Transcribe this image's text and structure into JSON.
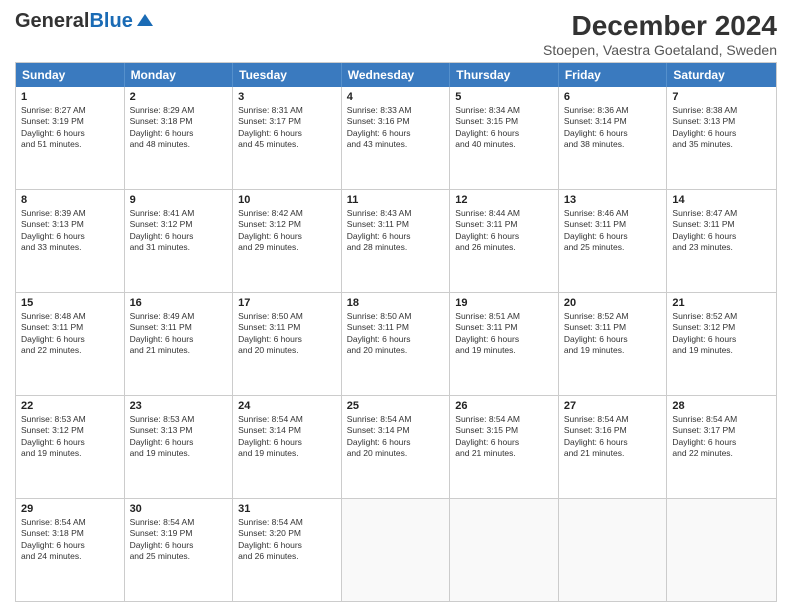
{
  "header": {
    "logo_line1": "General",
    "logo_line2": "Blue",
    "title": "December 2024",
    "subtitle": "Stoepen, Vaestra Goetaland, Sweden"
  },
  "days_of_week": [
    "Sunday",
    "Monday",
    "Tuesday",
    "Wednesday",
    "Thursday",
    "Friday",
    "Saturday"
  ],
  "weeks": [
    [
      {
        "day": "1",
        "lines": [
          "Sunrise: 8:27 AM",
          "Sunset: 3:19 PM",
          "Daylight: 6 hours",
          "and 51 minutes."
        ]
      },
      {
        "day": "2",
        "lines": [
          "Sunrise: 8:29 AM",
          "Sunset: 3:18 PM",
          "Daylight: 6 hours",
          "and 48 minutes."
        ]
      },
      {
        "day": "3",
        "lines": [
          "Sunrise: 8:31 AM",
          "Sunset: 3:17 PM",
          "Daylight: 6 hours",
          "and 45 minutes."
        ]
      },
      {
        "day": "4",
        "lines": [
          "Sunrise: 8:33 AM",
          "Sunset: 3:16 PM",
          "Daylight: 6 hours",
          "and 43 minutes."
        ]
      },
      {
        "day": "5",
        "lines": [
          "Sunrise: 8:34 AM",
          "Sunset: 3:15 PM",
          "Daylight: 6 hours",
          "and 40 minutes."
        ]
      },
      {
        "day": "6",
        "lines": [
          "Sunrise: 8:36 AM",
          "Sunset: 3:14 PM",
          "Daylight: 6 hours",
          "and 38 minutes."
        ]
      },
      {
        "day": "7",
        "lines": [
          "Sunrise: 8:38 AM",
          "Sunset: 3:13 PM",
          "Daylight: 6 hours",
          "and 35 minutes."
        ]
      }
    ],
    [
      {
        "day": "8",
        "lines": [
          "Sunrise: 8:39 AM",
          "Sunset: 3:13 PM",
          "Daylight: 6 hours",
          "and 33 minutes."
        ]
      },
      {
        "day": "9",
        "lines": [
          "Sunrise: 8:41 AM",
          "Sunset: 3:12 PM",
          "Daylight: 6 hours",
          "and 31 minutes."
        ]
      },
      {
        "day": "10",
        "lines": [
          "Sunrise: 8:42 AM",
          "Sunset: 3:12 PM",
          "Daylight: 6 hours",
          "and 29 minutes."
        ]
      },
      {
        "day": "11",
        "lines": [
          "Sunrise: 8:43 AM",
          "Sunset: 3:11 PM",
          "Daylight: 6 hours",
          "and 28 minutes."
        ]
      },
      {
        "day": "12",
        "lines": [
          "Sunrise: 8:44 AM",
          "Sunset: 3:11 PM",
          "Daylight: 6 hours",
          "and 26 minutes."
        ]
      },
      {
        "day": "13",
        "lines": [
          "Sunrise: 8:46 AM",
          "Sunset: 3:11 PM",
          "Daylight: 6 hours",
          "and 25 minutes."
        ]
      },
      {
        "day": "14",
        "lines": [
          "Sunrise: 8:47 AM",
          "Sunset: 3:11 PM",
          "Daylight: 6 hours",
          "and 23 minutes."
        ]
      }
    ],
    [
      {
        "day": "15",
        "lines": [
          "Sunrise: 8:48 AM",
          "Sunset: 3:11 PM",
          "Daylight: 6 hours",
          "and 22 minutes."
        ]
      },
      {
        "day": "16",
        "lines": [
          "Sunrise: 8:49 AM",
          "Sunset: 3:11 PM",
          "Daylight: 6 hours",
          "and 21 minutes."
        ]
      },
      {
        "day": "17",
        "lines": [
          "Sunrise: 8:50 AM",
          "Sunset: 3:11 PM",
          "Daylight: 6 hours",
          "and 20 minutes."
        ]
      },
      {
        "day": "18",
        "lines": [
          "Sunrise: 8:50 AM",
          "Sunset: 3:11 PM",
          "Daylight: 6 hours",
          "and 20 minutes."
        ]
      },
      {
        "day": "19",
        "lines": [
          "Sunrise: 8:51 AM",
          "Sunset: 3:11 PM",
          "Daylight: 6 hours",
          "and 19 minutes."
        ]
      },
      {
        "day": "20",
        "lines": [
          "Sunrise: 8:52 AM",
          "Sunset: 3:11 PM",
          "Daylight: 6 hours",
          "and 19 minutes."
        ]
      },
      {
        "day": "21",
        "lines": [
          "Sunrise: 8:52 AM",
          "Sunset: 3:12 PM",
          "Daylight: 6 hours",
          "and 19 minutes."
        ]
      }
    ],
    [
      {
        "day": "22",
        "lines": [
          "Sunrise: 8:53 AM",
          "Sunset: 3:12 PM",
          "Daylight: 6 hours",
          "and 19 minutes."
        ]
      },
      {
        "day": "23",
        "lines": [
          "Sunrise: 8:53 AM",
          "Sunset: 3:13 PM",
          "Daylight: 6 hours",
          "and 19 minutes."
        ]
      },
      {
        "day": "24",
        "lines": [
          "Sunrise: 8:54 AM",
          "Sunset: 3:14 PM",
          "Daylight: 6 hours",
          "and 19 minutes."
        ]
      },
      {
        "day": "25",
        "lines": [
          "Sunrise: 8:54 AM",
          "Sunset: 3:14 PM",
          "Daylight: 6 hours",
          "and 20 minutes."
        ]
      },
      {
        "day": "26",
        "lines": [
          "Sunrise: 8:54 AM",
          "Sunset: 3:15 PM",
          "Daylight: 6 hours",
          "and 21 minutes."
        ]
      },
      {
        "day": "27",
        "lines": [
          "Sunrise: 8:54 AM",
          "Sunset: 3:16 PM",
          "Daylight: 6 hours",
          "and 21 minutes."
        ]
      },
      {
        "day": "28",
        "lines": [
          "Sunrise: 8:54 AM",
          "Sunset: 3:17 PM",
          "Daylight: 6 hours",
          "and 22 minutes."
        ]
      }
    ],
    [
      {
        "day": "29",
        "lines": [
          "Sunrise: 8:54 AM",
          "Sunset: 3:18 PM",
          "Daylight: 6 hours",
          "and 24 minutes."
        ]
      },
      {
        "day": "30",
        "lines": [
          "Sunrise: 8:54 AM",
          "Sunset: 3:19 PM",
          "Daylight: 6 hours",
          "and 25 minutes."
        ]
      },
      {
        "day": "31",
        "lines": [
          "Sunrise: 8:54 AM",
          "Sunset: 3:20 PM",
          "Daylight: 6 hours",
          "and 26 minutes."
        ]
      },
      {
        "day": "",
        "lines": []
      },
      {
        "day": "",
        "lines": []
      },
      {
        "day": "",
        "lines": []
      },
      {
        "day": "",
        "lines": []
      }
    ]
  ]
}
